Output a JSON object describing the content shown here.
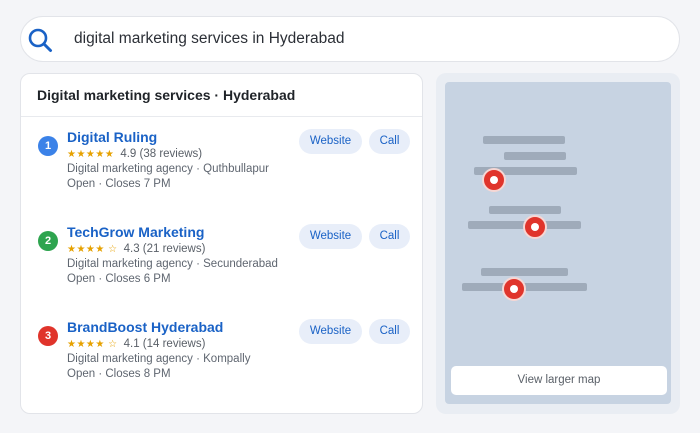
{
  "search": {
    "query": "digital marketing services in Hyderabad"
  },
  "results": {
    "title": "Digital marketing services · Hyderabad",
    "listings": [
      {
        "rank": "1",
        "badge_color": "#3b82e8",
        "name": "Digital Ruling",
        "stars": "★★★★★",
        "rating": "4.9 (38 reviews)",
        "category_location": "Digital marketing agency · Quthbullapur",
        "hours": "Open · Closes 7 PM",
        "website_label": "Website",
        "call_label": "Call"
      },
      {
        "rank": "2",
        "badge_color": "#2ea44f",
        "name": "TechGrow Marketing",
        "stars": "★★★★ ☆",
        "rating": "4.3 (21 reviews)",
        "category_location": "Digital marketing agency · Secunderabad",
        "hours": "Open · Closes 6 PM",
        "website_label": "Website",
        "call_label": "Call"
      },
      {
        "rank": "3",
        "badge_color": "#e0342b",
        "name": "BrandBoost Hyderabad",
        "stars": "★★★★ ☆",
        "rating": "4.1 (14 reviews)",
        "category_location": "Digital marketing agency · Kompally",
        "hours": "Open · Closes 8 PM",
        "website_label": "Website",
        "call_label": "Call"
      }
    ]
  },
  "map": {
    "view_larger_label": "View larger map",
    "pin_color": "#e0342b"
  }
}
